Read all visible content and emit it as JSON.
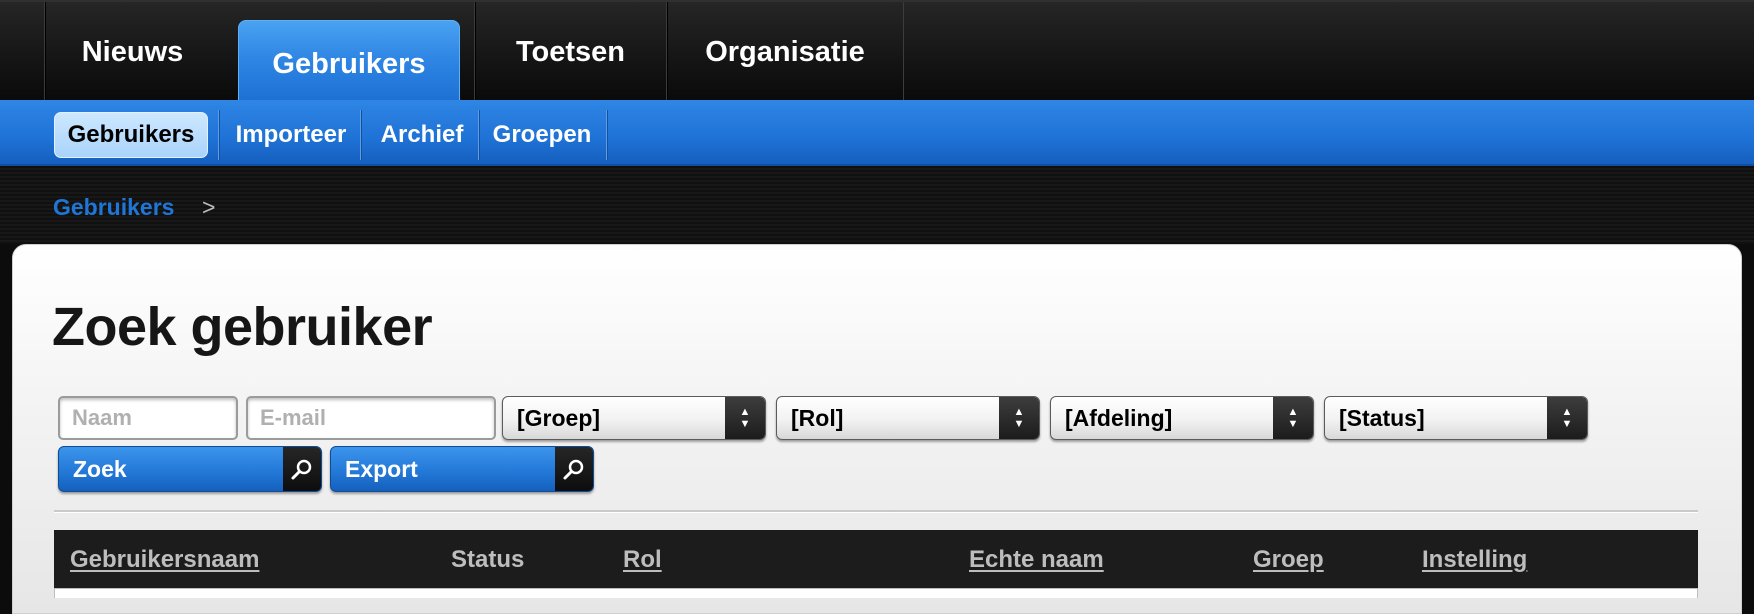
{
  "top_nav": {
    "tabs": [
      {
        "label": "Nieuws"
      },
      {
        "label": "Gebruikers"
      },
      {
        "label": "Toetsen"
      },
      {
        "label": "Organisatie"
      }
    ]
  },
  "sub_nav": {
    "tabs": [
      {
        "label": "Gebruikers"
      },
      {
        "label": "Importeer"
      },
      {
        "label": "Archief"
      },
      {
        "label": "Groepen"
      }
    ]
  },
  "breadcrumb": {
    "link": "Gebruikers",
    "separator": ">"
  },
  "page": {
    "title": "Zoek gebruiker"
  },
  "search": {
    "name_placeholder": "Naam",
    "email_placeholder": "E-mail",
    "group_select": "[Groep]",
    "role_select": "[Rol]",
    "department_select": "[Afdeling]",
    "status_select": "[Status]",
    "search_button": "Zoek",
    "export_button": "Export"
  },
  "table": {
    "headers": [
      "Gebruikersnaam",
      "Status",
      "Rol",
      "Echte naam",
      "Groep",
      "Instelling"
    ]
  }
}
